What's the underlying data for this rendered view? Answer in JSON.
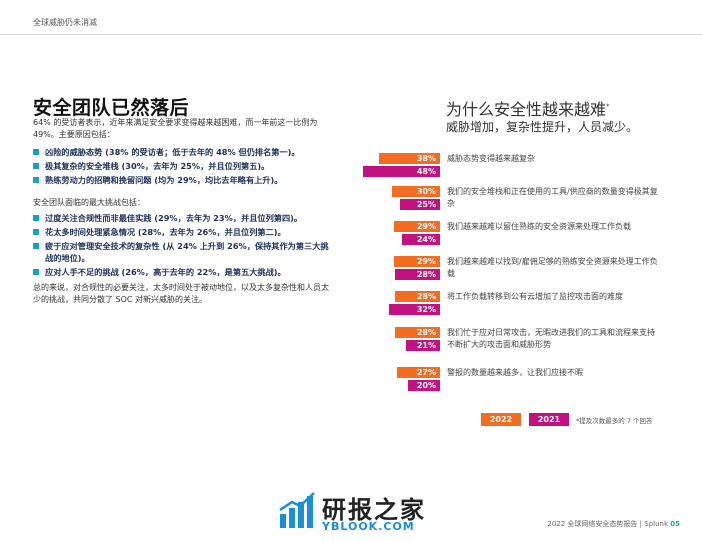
{
  "header": {
    "section": "全球威胁仍未消减"
  },
  "left": {
    "title": "安全团队已然落后",
    "intro": "64% 的受访者表示，近年来满足安全要求变得越来越困难，而一年前这一比例为 49%。主要原因包括：",
    "reasons": [
      "凶险的威胁态势 (38% 的受访者；低于去年的 48% 但仍排名第一)。",
      "极其复杂的安全堆栈 (30%，去年为 25%，并且位列第五)。",
      "熟练劳动力的招聘和挽留问题 (均为 29%，均比去年略有上升)。"
    ],
    "challenges_intro": "安全团队面临的最大挑战包括：",
    "challenges": [
      "过度关注合规性而非最佳实践 (29%，去年为 23%，并且位列第四)。",
      "花太多时间处理紧急情况 (28%，去年为 26%，并且位列第二)。",
      "疲于应对管理安全技术的复杂性 (从 24% 上升到 26%，保持其作为第三大挑战的地位)。",
      "应对人手不足的挑战 (26%，高于去年的 22%，是第五大挑战)。"
    ],
    "summary": "总的来说，对合规性的必要关注，太多时间处于被动地位，以及太多复杂性和人员太少的挑战，共同分散了 SOC 对新兴威胁的关注。"
  },
  "right": {
    "title": "为什么安全性越来越难",
    "title_mark": "*",
    "subtitle": "威胁增加，复杂性提升，人员减少。",
    "footnote": "*提及次数最多的 7 个回答"
  },
  "chart_data": {
    "type": "bar",
    "categories": [
      "威胁态势变得越来越复杂",
      "我们的安全堆栈和正在使用的工具/供应商的数量变得极其复杂",
      "我们越来越难以留住熟练的安全资源来处理工作负载",
      "我们越来越难以找到/雇佣足够的熟练安全资源来处理工作负载",
      "将工作负载转移到公有云增加了监控攻击面的难度",
      "我们忙于应对日常攻击，无暇改进我们的工具和流程来支持不断扩大的攻击面和威胁形势",
      "警报的数量越来越多，让我们应接不暇"
    ],
    "series": [
      {
        "name": "2022",
        "values": [
          38,
          30,
          29,
          29,
          28,
          28,
          27
        ],
        "labels": [
          "38%",
          "30%",
          "29%",
          "29%",
          "28%",
          "28%",
          "27%"
        ],
        "color": "#f26d21"
      },
      {
        "name": "2021",
        "values": [
          48,
          25,
          24,
          28,
          32,
          21,
          20
        ],
        "labels": [
          "48%",
          "25%",
          "24%",
          "28%",
          "32%",
          "21%",
          "20%"
        ],
        "color": "#c1127f"
      }
    ],
    "title": "",
    "xlabel": "",
    "ylabel": "",
    "legend": "bottom"
  },
  "watermark": {
    "cn": "研报之家",
    "en": "YBLOOK.COM"
  },
  "footer": {
    "report": "2022 全球网络安全态势报告",
    "sep": "|",
    "brand": "Splunk",
    "page": "05"
  }
}
